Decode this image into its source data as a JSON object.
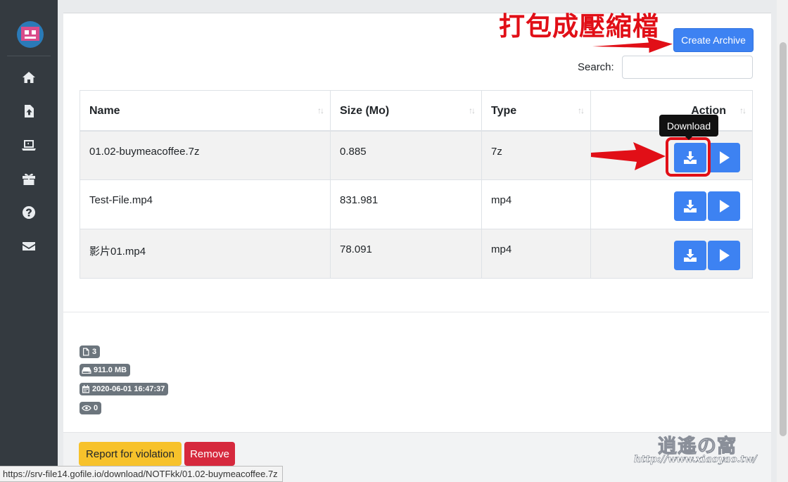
{
  "annotation": {
    "label": "打包成壓縮檔",
    "color": "#e10f17"
  },
  "sidebar": {
    "items": [
      {
        "icon": "home-icon"
      },
      {
        "icon": "file-upload-icon"
      },
      {
        "icon": "laptop-icon"
      },
      {
        "icon": "gift-icon"
      },
      {
        "icon": "question-circle-icon"
      },
      {
        "icon": "envelope-icon"
      }
    ]
  },
  "toolbar": {
    "create_archive_label": "Create Archive",
    "search_label": "Search:",
    "search_value": ""
  },
  "table": {
    "headers": [
      "Name",
      "Size (Mo)",
      "Type",
      "Action"
    ],
    "rows": [
      {
        "name": "01.02-buymeacoffee.7z",
        "size": "0.885",
        "type": "7z"
      },
      {
        "name": "Test-File.mp4",
        "size": "831.981",
        "type": "mp4"
      },
      {
        "name": "影片01.mp4",
        "size": "78.091",
        "type": "mp4"
      }
    ]
  },
  "tooltip": {
    "text": "Download"
  },
  "stats": {
    "files": "3",
    "size": "911.0 MB",
    "date": "2020-06-01 16:47:37",
    "views": "0"
  },
  "footer": {
    "report_label": "Report for violation",
    "remove_label": "Remove"
  },
  "status_bar": {
    "url": "https://srv-file14.gofile.io/download/NOTFkk/01.02-buymeacoffee.7z"
  },
  "watermark": {
    "title": "逍遙の窩",
    "url": "http://www.xiaoyao.tw/"
  },
  "colors": {
    "primary": "#3d82f2",
    "warning": "#f7c22b",
    "danger": "#d6293d",
    "sidebar": "#343a40",
    "badge": "#6c757d"
  }
}
